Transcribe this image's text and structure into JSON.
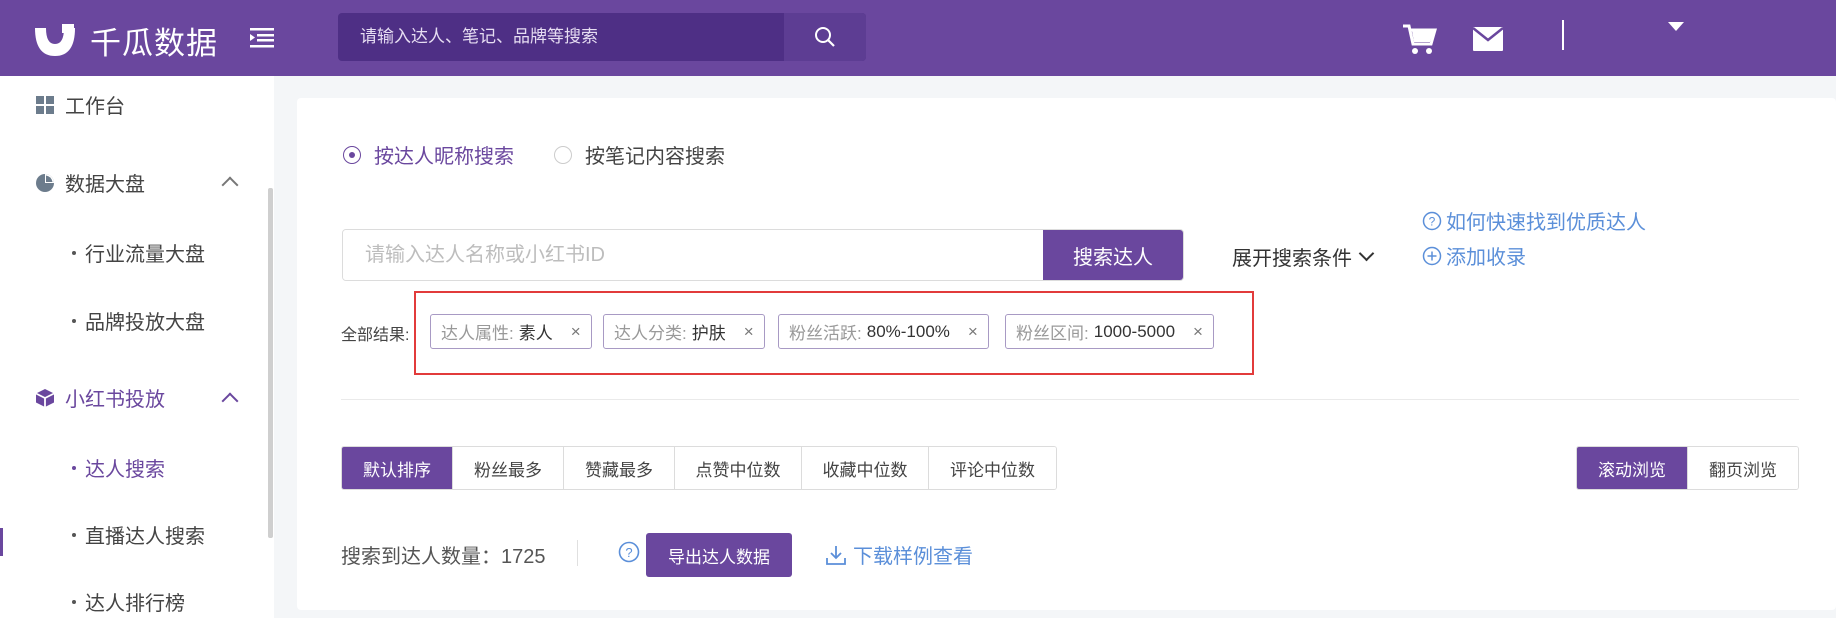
{
  "header": {
    "logo_text": "千瓜数据",
    "search_placeholder": "请输入达人、笔记、品牌等搜索",
    "icons": [
      "menu-icon",
      "search-icon",
      "cart-icon",
      "mail-icon",
      "caret-down-icon"
    ]
  },
  "sidebar": {
    "workbench": "工作台",
    "data_dashboard": "数据大盘",
    "industry_traffic": "行业流量大盘",
    "brand_ads": "品牌投放大盘",
    "xhs_ads": "小红书投放",
    "kol_search": "达人搜索",
    "live_kol_search": "直播达人搜索",
    "kol_ranking": "达人排行榜"
  },
  "main": {
    "radio_nickname": "按达人昵称搜索",
    "radio_content": "按笔记内容搜索",
    "search_placeholder": "请输入达人名称或小红书ID",
    "search_button": "搜索达人",
    "expand_conditions": "展开搜索条件",
    "help_find": "如何快速找到优质达人",
    "add_record": "添加收录",
    "results_label": "全部结果:",
    "tags": [
      {
        "key": "达人属性:",
        "value": "素人",
        "close": "×"
      },
      {
        "key": "达人分类:",
        "value": "护肤",
        "close": "×"
      },
      {
        "key": "粉丝活跃:",
        "value": "80%-100%",
        "close": "×"
      },
      {
        "key": "粉丝区间:",
        "value": "1000-5000",
        "close": "×"
      }
    ],
    "sort_tabs": [
      "默认排序",
      "粉丝最多",
      "赞藏最多",
      "点赞中位数",
      "收藏中位数",
      "评论中位数"
    ],
    "view_modes": [
      "滚动浏览",
      "翻页浏览"
    ],
    "count_text": "搜索到达人数量：1725",
    "export_button": "导出达人数据",
    "download_sample": "下载样例查看"
  },
  "colors": {
    "brand": "#6a479e",
    "link": "#5b8fd9",
    "highlight_box": "#e23b3b"
  }
}
